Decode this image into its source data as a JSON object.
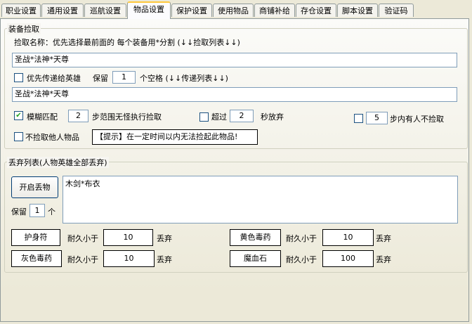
{
  "tabs": [
    "职业设置",
    "通用设置",
    "巡航设置",
    "物品设置",
    "保护设置",
    "使用物品",
    "商铺补给",
    "存仓设置",
    "脚本设置",
    "验证码"
  ],
  "active_tab": 3,
  "pickup": {
    "group_title": "装备捡取",
    "name_hint": "捡取名称：优先选择最前面的 每个装备用*分割  (↓↓捡取列表↓↓)",
    "pickup_list": "圣战*法神*天尊",
    "pass_hero_label": "优先传递给英雄",
    "pass_hero_checked": false,
    "keep_label": "保留",
    "keep_value": "1",
    "keep_suffix": "个空格 (↓↓传递列表↓↓)",
    "pass_list": "圣战*法神*天尊",
    "fuzzy_label": "模糊匹配",
    "fuzzy_checked": true,
    "fuzzy_value": "2",
    "fuzzy_suffix": "步范围无怪执行捡取",
    "exceed_label": "超过",
    "exceed_checked": false,
    "exceed_value": "2",
    "exceed_suffix": "秒放弃",
    "near_checked": false,
    "near_value": "5",
    "near_suffix": "步内有人不捡取",
    "no_pick_others_label": "不捡取他人物品",
    "no_pick_others_checked": false,
    "tip": "【提示】在一定时间以内无法捡起此物品!"
  },
  "discard": {
    "group_title": "丢弃列表(人物英雄全部丢弃)",
    "start_button": "开启丢物",
    "list": "木剑*布衣",
    "keep_label": "保留",
    "keep_value": "1",
    "keep_unit": "个",
    "rows": [
      {
        "item": "护身符",
        "durability_label": "耐久小于",
        "value": "10",
        "action": "丢弃"
      },
      {
        "item": "黄色毒药",
        "durability_label": "耐久小于",
        "value": "10",
        "action": "丢弃"
      },
      {
        "item": "灰色毒药",
        "durability_label": "耐久小于",
        "value": "10",
        "action": "丢弃"
      },
      {
        "item": "魔血石",
        "durability_label": "耐久小于",
        "value": "100",
        "action": "丢弃"
      }
    ]
  },
  "colors": {
    "accent": "#ffc83c",
    "border": "#7f9db9",
    "bg": "#ece9d8"
  }
}
